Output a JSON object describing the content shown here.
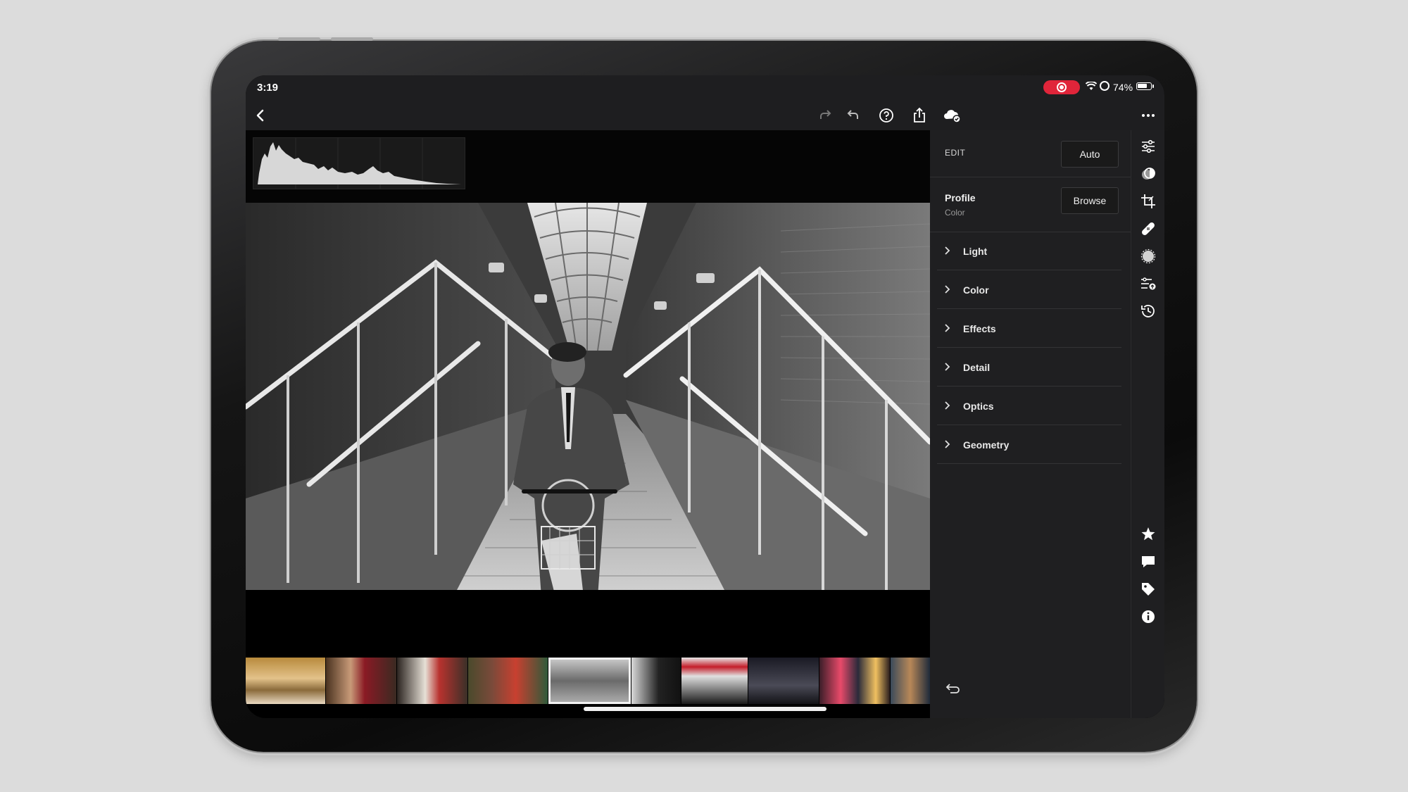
{
  "status_bar": {
    "time": "3:19",
    "battery_percent": "74%",
    "battery_level": 0.74,
    "recording_color": "#e0253a"
  },
  "toolbar": {
    "icons": [
      "back-icon",
      "redo-icon",
      "undo-icon",
      "help-icon",
      "share-icon",
      "cloud-sync-icon",
      "more-icon"
    ]
  },
  "panel": {
    "edit_label": "EDIT",
    "auto_button": "Auto",
    "profile_title": "Profile",
    "profile_value": "Color",
    "browse_button": "Browse",
    "sections": [
      {
        "label": "Light"
      },
      {
        "label": "Color"
      },
      {
        "label": "Effects"
      },
      {
        "label": "Detail"
      },
      {
        "label": "Optics"
      },
      {
        "label": "Geometry"
      }
    ]
  },
  "tool_rail": {
    "top_icons": [
      "edit-sliders-icon",
      "presets-icon",
      "crop-icon",
      "healing-icon",
      "masking-icon",
      "versions-icon",
      "history-icon"
    ],
    "bottom_icons": [
      "rating-star-icon",
      "comment-icon",
      "tag-icon",
      "info-icon"
    ]
  },
  "filmstrip": {
    "thumbnail_count": 10,
    "selected_index": 4
  }
}
